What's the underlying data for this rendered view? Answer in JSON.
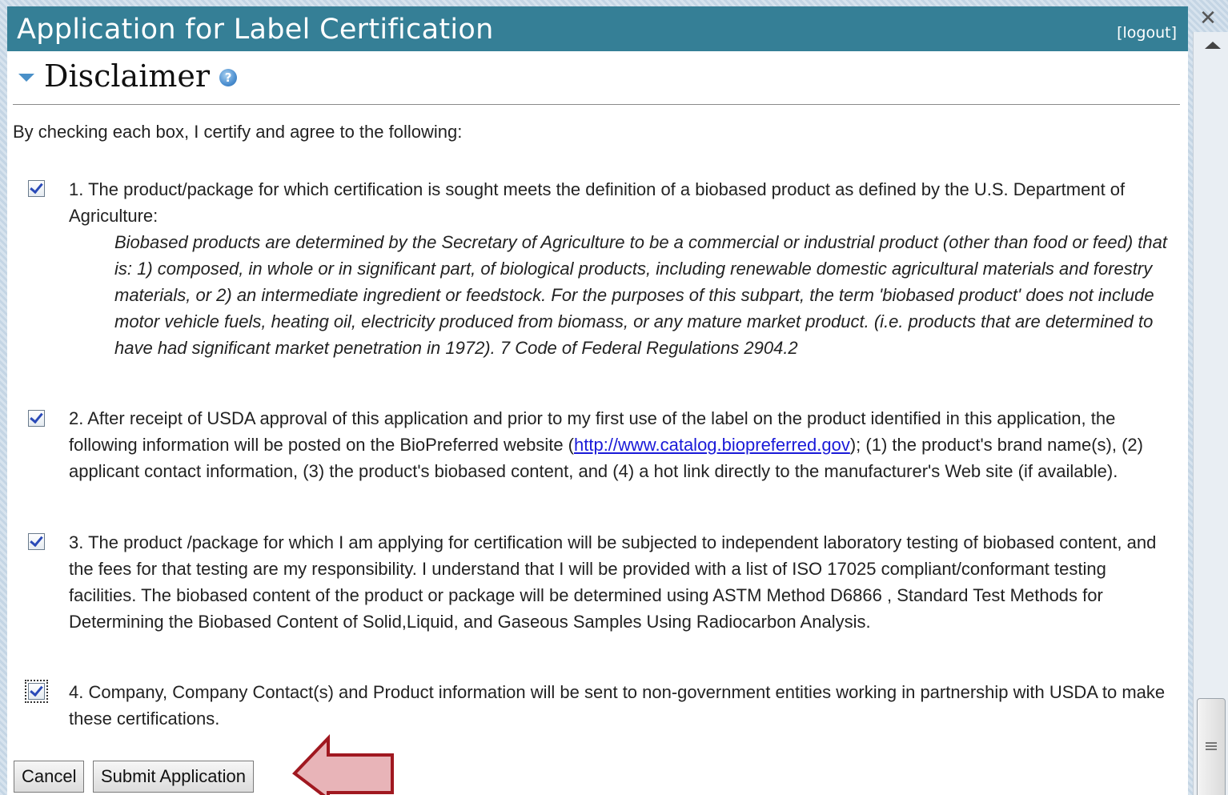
{
  "window": {
    "title": "Application for Label Certification",
    "logout_label": "[logout]"
  },
  "section": {
    "title": "Disclaimer",
    "help_icon": "?"
  },
  "intro": "By checking each box, I certify and agree to the following:",
  "items": [
    {
      "checked": true,
      "text": "1. The product/package for which certification is sought meets the definition of a biobased product as defined by the U.S. Department of Agriculture:",
      "quote": "Biobased products are determined by the Secretary of Agriculture to be a commercial or industrial product (other than food or feed) that is: 1) composed, in whole or in significant part, of biological products, including renewable domestic agricultural materials and forestry materials, or 2) an intermediate ingredient or feedstock. For the purposes of this subpart, the term 'biobased product' does not include motor vehicle fuels, heating oil, electricity produced from biomass, or any mature market product. (i.e. products that are determined to have had significant market penetration in 1972). 7 Code of Federal Regulations 2904.2"
    },
    {
      "checked": true,
      "text_before": "2. After receipt of USDA approval of this application and prior to my first use of the label on the product identified in this application, the following information will be posted on the BioPreferred website (",
      "link": "http://www.catalog.biopreferred.gov",
      "text_after": "); (1) the product's brand name(s), (2) applicant contact information, (3) the product's biobased content, and (4) a hot link directly to the manufacturer's Web site (if available)."
    },
    {
      "checked": true,
      "text": "3. The product /package for which I am applying for certification will be subjected to independent laboratory testing of biobased content, and the fees for that testing are my responsibility. I understand that I will be provided with a list of ISO 17025 compliant/conformant testing facilities. The biobased content of the product or package will be determined using ASTM Method D6866 , Standard Test Methods for Determining the Biobased Content of Solid,Liquid, and Gaseous Samples Using Radiocarbon Analysis."
    },
    {
      "checked": true,
      "text": "4. Company, Company Contact(s) and Product information will be sent to non-government entities working in partnership with USDA to make these certifications."
    }
  ],
  "buttons": {
    "cancel": "Cancel",
    "submit": "Submit Application"
  },
  "window_controls": {
    "close": "✕"
  },
  "colors": {
    "title_bar": "#357f96",
    "link": "#1a1ad8",
    "annotation_arrow_fill": "#e8b4b8",
    "annotation_arrow_stroke": "#a01820"
  }
}
